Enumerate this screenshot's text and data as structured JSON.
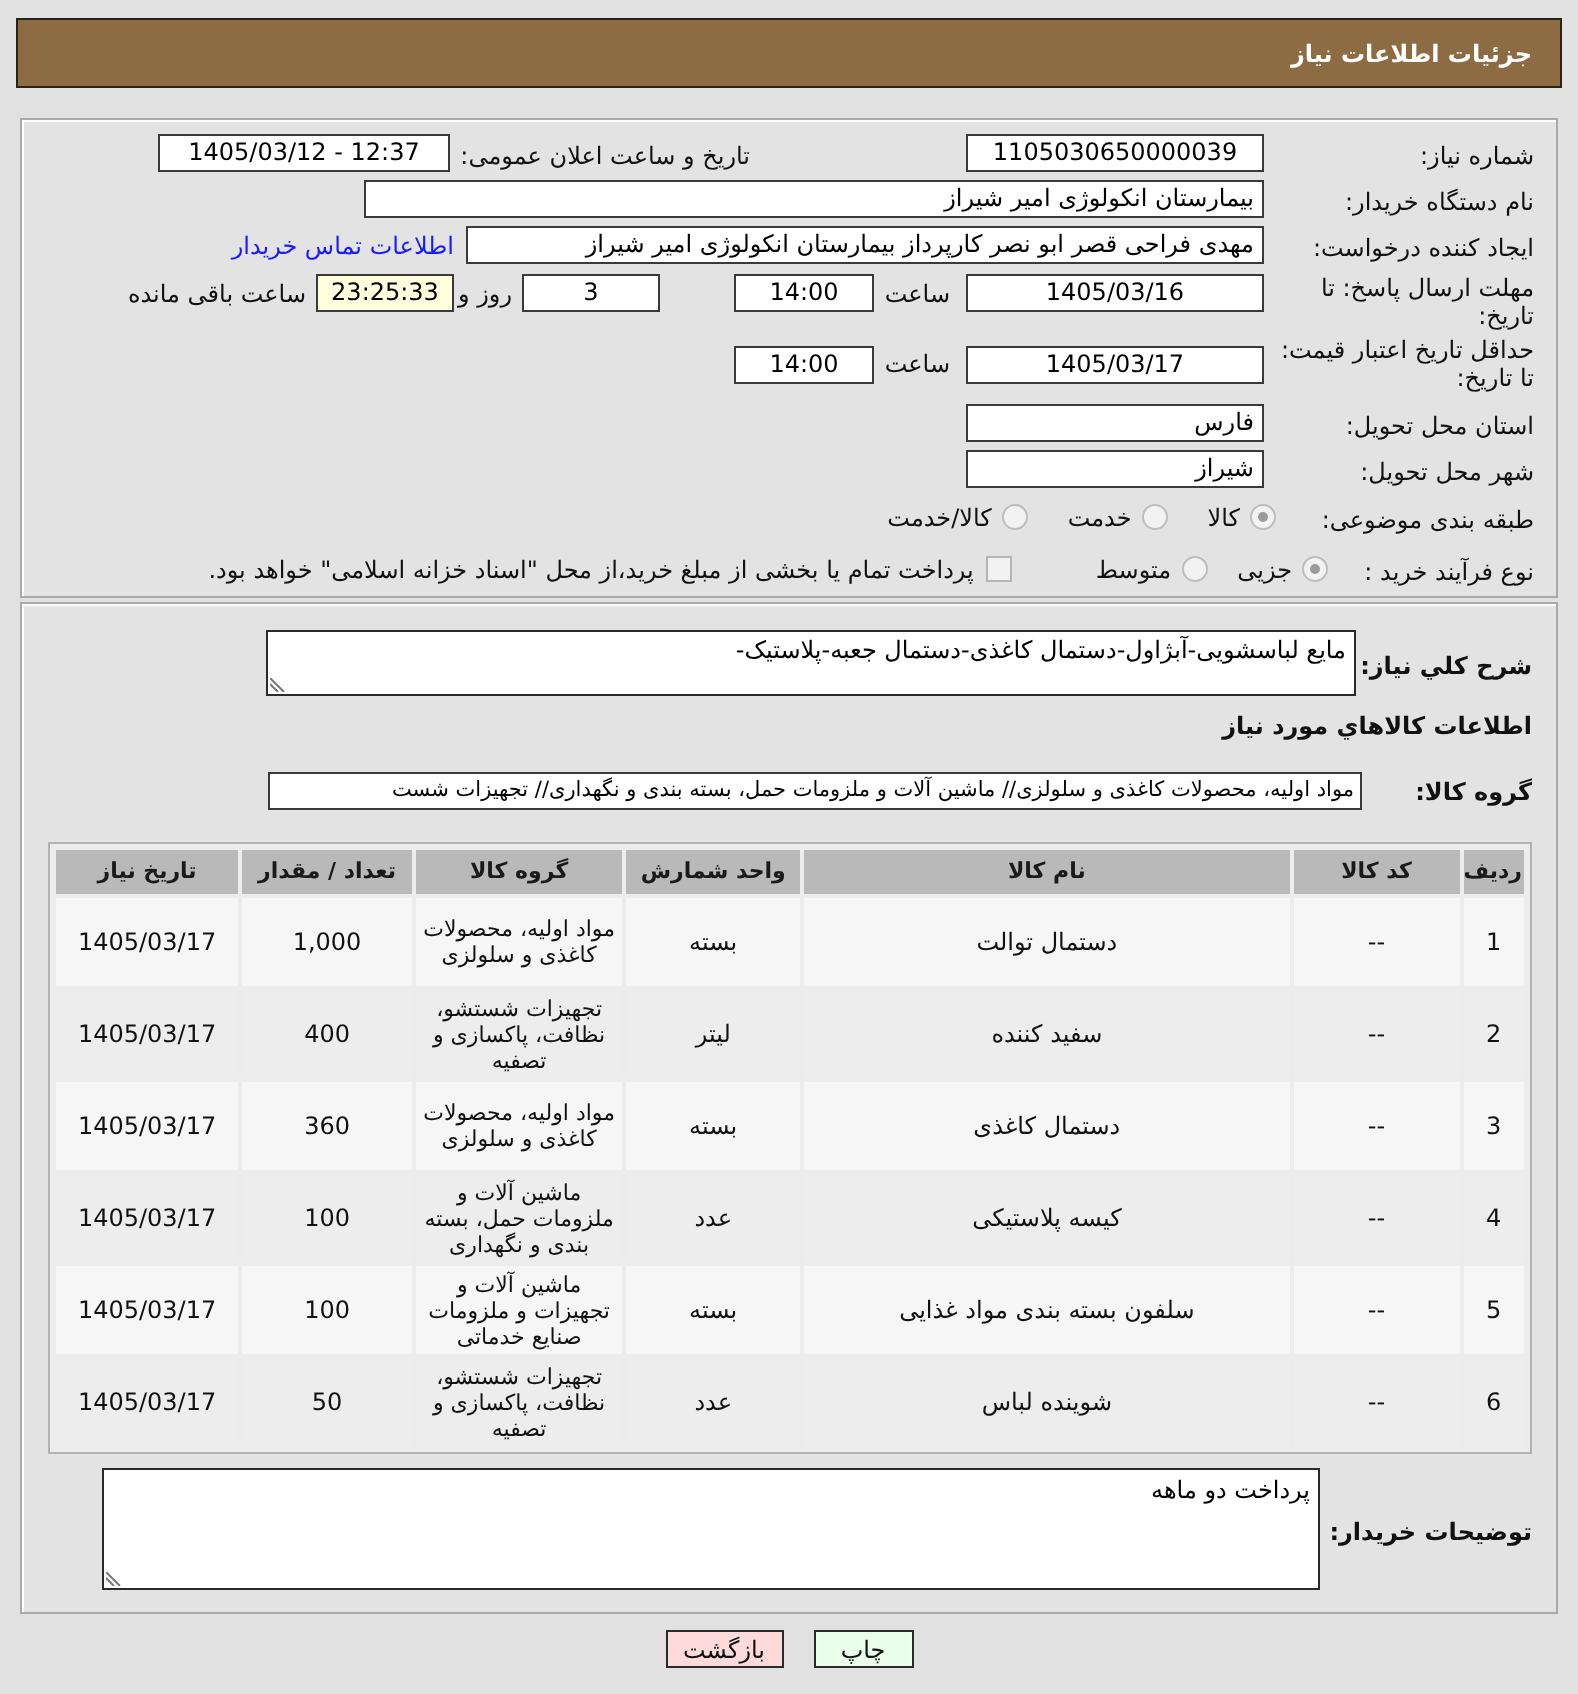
{
  "header": {
    "title": "جزئیات اطلاعات نیاز"
  },
  "details": {
    "need_number": {
      "label": "شماره نیاز:",
      "value": "1105030650000039"
    },
    "announcement": {
      "label": "تاریخ و ساعت اعلان عمومی:",
      "value": "1405/03/12 - 12:37"
    },
    "buyer_org": {
      "label": "نام دستگاه خریدار:",
      "value": "بیمارستان انکولوژی امیر شیراز"
    },
    "requester": {
      "label": "ایجاد کننده درخواست:",
      "value": "مهدی فراحی قصر ابو نصر کارپرداز بیمارستان انکولوژی امیر شیراز",
      "contact_link": "اطلاعات تماس خریدار"
    },
    "response_deadline": {
      "label": "مهلت ارسال پاسخ: تا تاریخ:",
      "date": "1405/03/16",
      "time_label": "ساعت",
      "time": "14:00",
      "days": "3",
      "days_label": "روز و",
      "remaining": "23:25:33",
      "remaining_label": "ساعت باقی مانده"
    },
    "price_validity": {
      "label": "حداقل تاریخ اعتبار قیمت: تا تاریخ:",
      "date": "1405/03/17",
      "time_label": "ساعت",
      "time": "14:00"
    },
    "province": {
      "label": "استان محل تحویل:",
      "value": "فارس"
    },
    "city": {
      "label": "شهر محل تحویل:",
      "value": "شیراز"
    },
    "category": {
      "label": "طبقه بندی موضوعی:",
      "options": [
        {
          "label": "کالا",
          "selected": true
        },
        {
          "label": "خدمت",
          "selected": false
        },
        {
          "label": "کالا/خدمت",
          "selected": false
        }
      ]
    },
    "purchase_type": {
      "label": "نوع فرآیند خرید :",
      "options": [
        {
          "label": "جزیی",
          "selected": true
        },
        {
          "label": "متوسط",
          "selected": false
        }
      ],
      "treasury_payment": {
        "label": "پرداخت تمام یا بخشی از مبلغ خرید،از محل \"اسناد خزانه اسلامی\" خواهد بود.",
        "checked": false
      }
    }
  },
  "description": {
    "label": "شرح کلي نياز:",
    "value": "مایع لباسشویی-آبژاول-دستمال کاغذی-دستمال جعبه-پلاستیک-"
  },
  "goods_heading": "اطلاعات کالاهاي مورد نياز",
  "goods_group": {
    "label": "گروه کالا:",
    "value": "مواد اولیه، محصولات کاغذی و سلولزی// ماشین آلات و ملزومات حمل، بسته بندی و نگهداری// تجهیزات شست"
  },
  "table": {
    "columns": [
      "ردیف",
      "کد کالا",
      "نام کالا",
      "واحد شمارش",
      "گروه کالا",
      "تعداد / مقدار",
      "تاریخ نیاز"
    ],
    "rows": [
      {
        "row": "1",
        "code": "--",
        "name": "دستمال توالت",
        "unit": "بسته",
        "group": "مواد اولیه، محصولات کاغذی و سلولزی",
        "quantity": "1,000",
        "date": "1405/03/17"
      },
      {
        "row": "2",
        "code": "--",
        "name": "سفید کننده",
        "unit": "لیتر",
        "group": "تجهیزات شستشو، نظافت، پاکسازی و تصفیه",
        "quantity": "400",
        "date": "1405/03/17"
      },
      {
        "row": "3",
        "code": "--",
        "name": "دستمال کاغذی",
        "unit": "بسته",
        "group": "مواد اولیه، محصولات کاغذی و سلولزی",
        "quantity": "360",
        "date": "1405/03/17"
      },
      {
        "row": "4",
        "code": "--",
        "name": "کیسه پلاستیکی",
        "unit": "عدد",
        "group": "ماشین آلات و ملزومات حمل، بسته بندی و نگهداری",
        "quantity": "100",
        "date": "1405/03/17"
      },
      {
        "row": "5",
        "code": "--",
        "name": "سلفون بسته بندی مواد غذایی",
        "unit": "بسته",
        "group": "ماشین آلات و تجهیزات و ملزومات صنایع خدماتی",
        "quantity": "100",
        "date": "1405/03/17"
      },
      {
        "row": "6",
        "code": "--",
        "name": "شوینده لباس",
        "unit": "عدد",
        "group": "تجهیزات شستشو، نظافت، پاکسازی و تصفیه",
        "quantity": "50",
        "date": "1405/03/17"
      }
    ]
  },
  "buyer_notes": {
    "label": "توضیحات خریدار:",
    "value": "پرداخت دو ماهه"
  },
  "buttons": [
    {
      "label": "چاپ",
      "kind": "print"
    },
    {
      "label": "بازگشت",
      "kind": "back"
    }
  ]
}
